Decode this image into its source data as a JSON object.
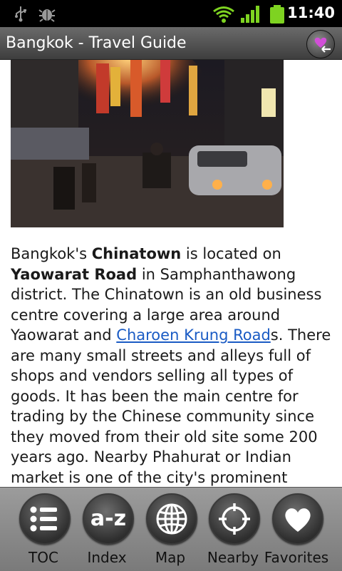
{
  "status_bar": {
    "time": "11:40",
    "icons": [
      "usb-icon",
      "debug-icon",
      "wifi-icon",
      "signal-icon",
      "battery-icon"
    ]
  },
  "app_bar": {
    "title": "Bangkok - Travel Guide",
    "action_icon": "add-favorite-icon"
  },
  "article": {
    "image_subject": "Chinatown street at night",
    "segments": [
      {
        "text": "Bangkok's ",
        "style": "normal"
      },
      {
        "text": "Chinatown",
        "style": "bold"
      },
      {
        "text": " is located on ",
        "style": "normal"
      },
      {
        "text": "Yaowarat Road",
        "style": "bold"
      },
      {
        "text": " in Samphanthawong district. The Chinatown is an old business centre covering a large area around Yaowarat and ",
        "style": "normal"
      },
      {
        "text": "Charoen Krung Road",
        "style": "link"
      },
      {
        "text": "s. There are many small streets and alleys full of shops and vendors selling all types of goods. It has been the main centre for trading by the Chinese community since they moved from their old site some 200 years ago. Nearby Phahurat or Indian market is one of the city's prominent",
        "style": "normal"
      }
    ]
  },
  "bottom_nav": [
    {
      "label": "TOC",
      "icon": "list-icon"
    },
    {
      "label": "Index",
      "icon": "a-z-icon",
      "glyph": "a-z"
    },
    {
      "label": "Map",
      "icon": "globe-icon"
    },
    {
      "label": "Nearby",
      "icon": "crosshair-icon"
    },
    {
      "label": "Favorites",
      "icon": "heart-icon"
    }
  ],
  "colors": {
    "link": "#1a5bc4",
    "title_bar": "#4e4e4e",
    "status_bar": "#000000",
    "bottom_bar": "#8c8c8c",
    "accent_green": "#7ed321",
    "heart": "#d24fd8"
  }
}
